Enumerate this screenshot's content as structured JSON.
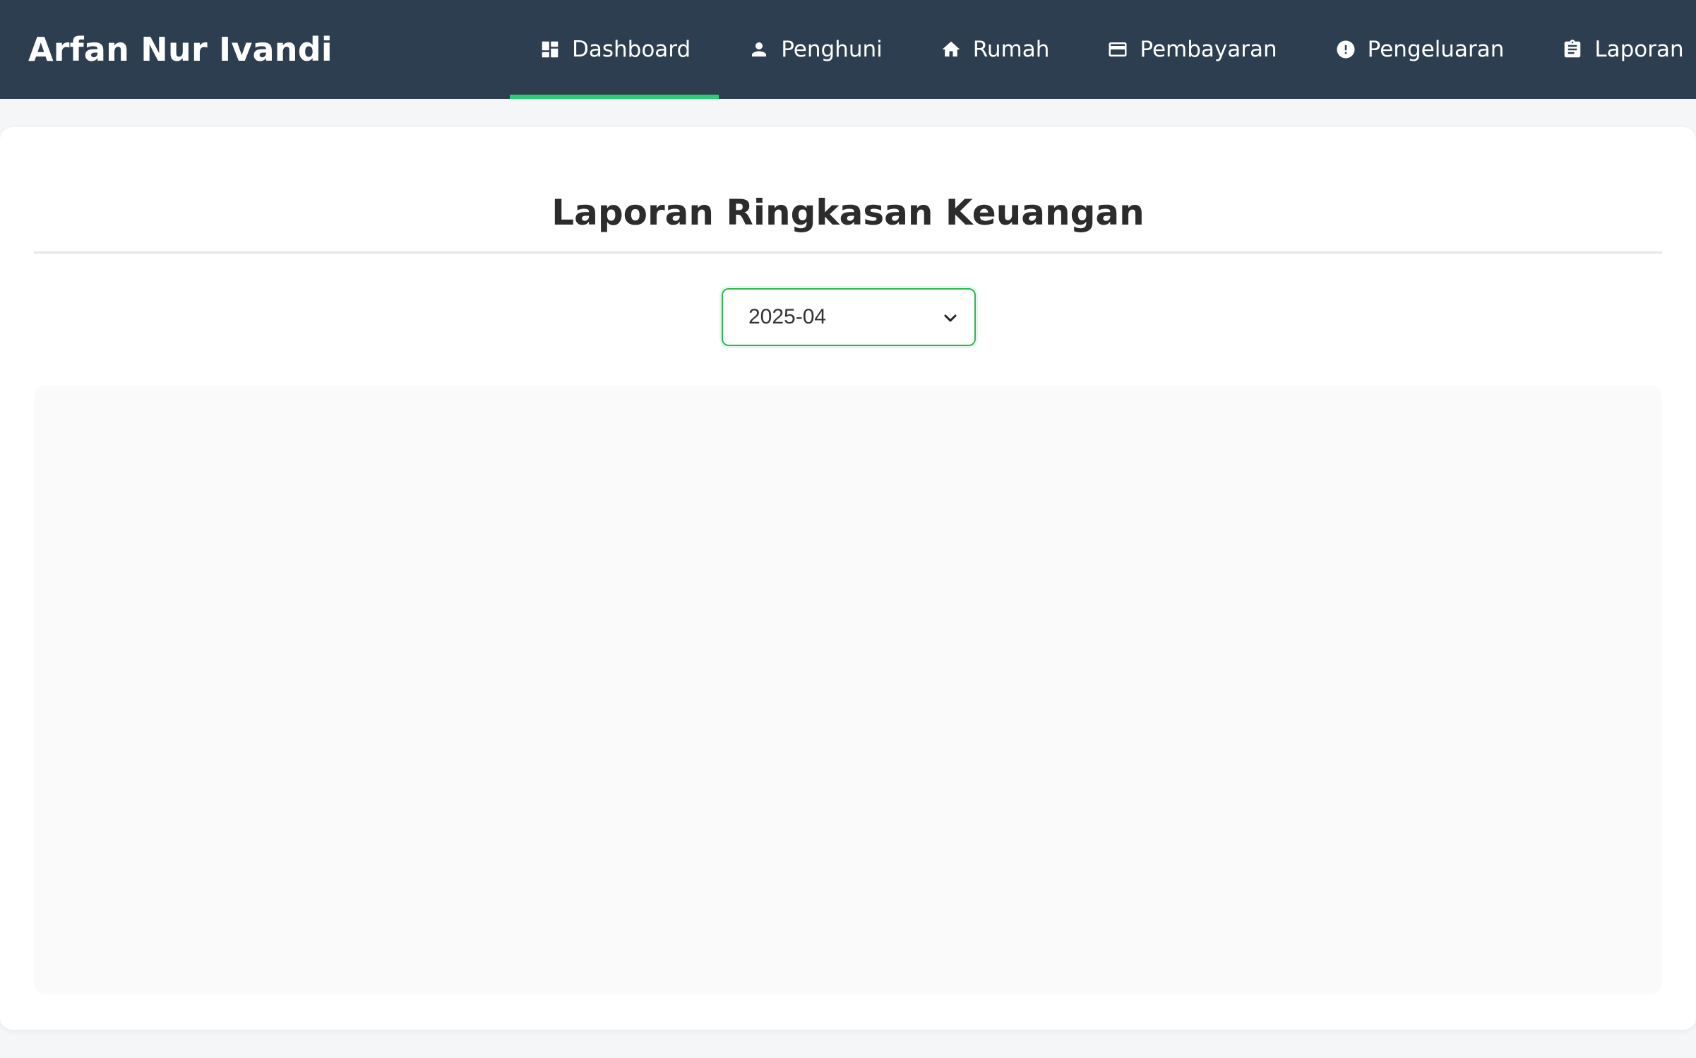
{
  "header": {
    "brand": "Arfan Nur Ivandi",
    "nav": [
      {
        "label": "Dashboard",
        "icon": "dashboard-icon",
        "active": true
      },
      {
        "label": "Penghuni",
        "icon": "person-icon",
        "active": false
      },
      {
        "label": "Rumah",
        "icon": "home-icon",
        "active": false
      },
      {
        "label": "Pembayaran",
        "icon": "credit-card-icon",
        "active": false
      },
      {
        "label": "Pengeluaran",
        "icon": "alert-circle-icon",
        "active": false
      },
      {
        "label": "Laporan",
        "icon": "clipboard-icon",
        "active": false
      }
    ]
  },
  "main": {
    "title": "Laporan Ringkasan Keuangan",
    "period": {
      "selected": "2025-04"
    }
  },
  "colors": {
    "header_bg": "#2d3e50",
    "active_underline": "#2ecc71",
    "select_border": "#2eb84f"
  }
}
